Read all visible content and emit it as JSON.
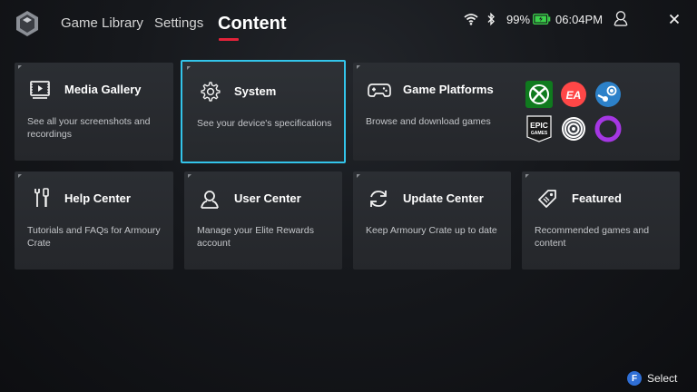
{
  "header": {
    "nav": {
      "game_library": "Game Library",
      "settings": "Settings",
      "content": "Content"
    },
    "status": {
      "battery_percent": "99%",
      "time": "06:04PM"
    },
    "accent_color": "#e4233a"
  },
  "cards": {
    "media_gallery": {
      "title": "Media Gallery",
      "desc": "See all your screenshots and recordings",
      "icon": "play-gallery-icon"
    },
    "system": {
      "title": "System",
      "desc": "See your device's specifications",
      "icon": "gear-icon",
      "selected": true
    },
    "game_platforms": {
      "title": "Game Platforms",
      "desc": "Browse and download games",
      "icon": "gamepad-icon",
      "platforms": [
        "xbox-logo",
        "ea-logo",
        "steam-logo",
        "epic-games-logo",
        "ubisoft-logo",
        "gog-logo"
      ],
      "epic_text_1": "EPIC",
      "epic_text_2": "GAMES",
      "ea_text": "EA"
    },
    "help_center": {
      "title": "Help Center",
      "desc": "Tutorials and FAQs for Armoury Crate",
      "icon": "tools-icon"
    },
    "user_center": {
      "title": "User Center",
      "desc": "Manage your Elite Rewards account",
      "icon": "user-icon"
    },
    "update_center": {
      "title": "Update Center",
      "desc": "Keep Armoury Crate up to date",
      "icon": "refresh-icon"
    },
    "featured": {
      "title": "Featured",
      "desc": "Recommended games and content",
      "icon": "tag-icon"
    }
  },
  "footer": {
    "select_button": "F",
    "select_label": "Select"
  },
  "colors": {
    "selection_border": "#33c4ea",
    "select_button": "#2f6fd6"
  }
}
